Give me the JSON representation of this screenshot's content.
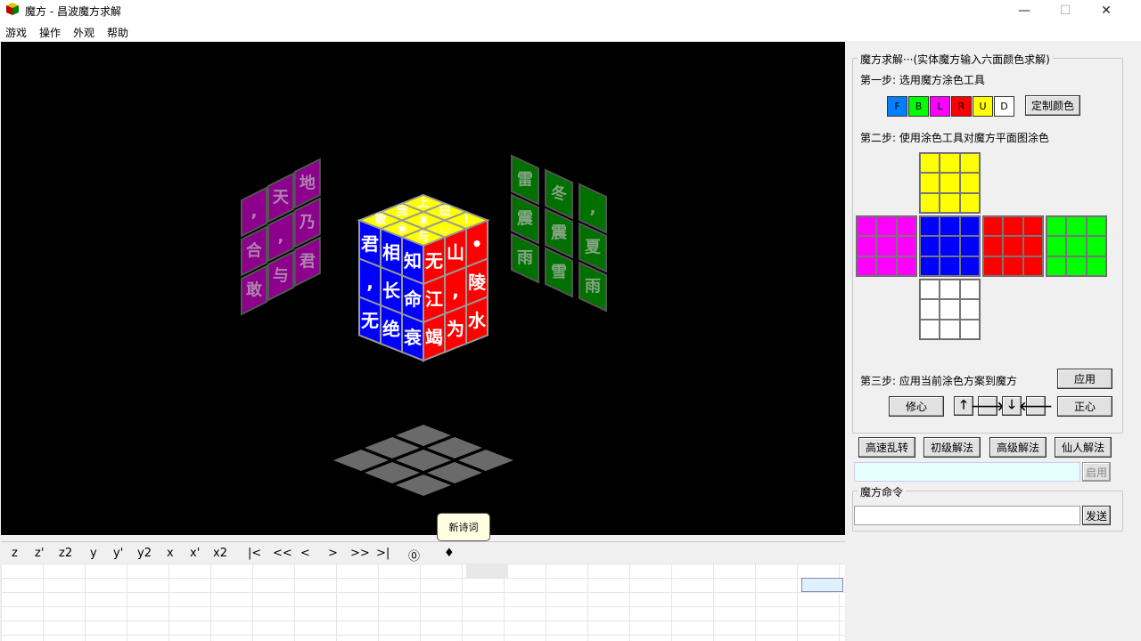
{
  "window": {
    "title": "魔方 - 昌波魔方求解",
    "minimize": "—",
    "maximize": "☐",
    "close": "✕"
  },
  "menu": [
    "游戏",
    "操作",
    "外观",
    "帮助"
  ],
  "cube": {
    "top_labels": [
      "上",
      "班",
      "!",
      "我",
      "◉",
      "◡",
      "敬",
      "◉",
      "与"
    ],
    "front_labels": [
      "君",
      "相",
      "知",
      ",",
      "长",
      "命",
      "无",
      "绝",
      "衰"
    ],
    "right_labels": [
      "无",
      "山",
      "•",
      "江",
      ",",
      "陵",
      "竭",
      "为",
      "水"
    ],
    "left_ghost": [
      ",",
      "天",
      "地",
      "合",
      ",",
      "乃",
      "敢",
      "与",
      "君"
    ],
    "right_ghost": [
      "雷",
      "冬",
      ",",
      "震",
      "震",
      "夏",
      "雨",
      "雪",
      "雨"
    ],
    "colors": {
      "top": "#ffff00",
      "front": "#0000ff",
      "right": "#ff0000",
      "left": "#ff00ff",
      "back": "#00cc00"
    }
  },
  "panel": {
    "group_title": "魔方求解···(实体魔方输入六面颜色求解)",
    "step1": "第一步: 选用魔方涂色工具",
    "swatches": [
      {
        "label": "F",
        "color": "#0080ff"
      },
      {
        "label": "B",
        "color": "#00ff00"
      },
      {
        "label": "L",
        "color": "#ff00ff"
      },
      {
        "label": "R",
        "color": "#ff0000"
      },
      {
        "label": "U",
        "color": "#ffff00"
      },
      {
        "label": "D",
        "color": "#ffffff"
      }
    ],
    "custom_color": "定制颜色",
    "step2": "第二步: 使用涂色工具对魔方平面图涂色",
    "net_colors": {
      "up": "#ffff00",
      "left": "#ff00ff",
      "front": "#0000ff",
      "right": "#ff0000",
      "back": "#00ff00",
      "down": "#ffffff"
    },
    "step3": "第三步: 应用当前涂色方案到魔方",
    "apply": "应用",
    "xiuxin": "修心",
    "zhengxin": "正心",
    "arrows": [
      "🡑",
      "🡒",
      "🡓",
      "🡐"
    ]
  },
  "solve_buttons": [
    "高速乱转",
    "初级解法",
    "高级解法",
    "仙人解法"
  ],
  "enable_btn": "启用",
  "command": {
    "title": "魔方命令",
    "send": "发送",
    "value": ""
  },
  "moves": [
    "z",
    "z'",
    "z2",
    "y",
    "y'",
    "y2",
    "x",
    "x'",
    "x2",
    "|<",
    "<<",
    "<",
    ">",
    ">>",
    ">|",
    "⓪",
    "♦"
  ],
  "tooltip": "新诗词"
}
